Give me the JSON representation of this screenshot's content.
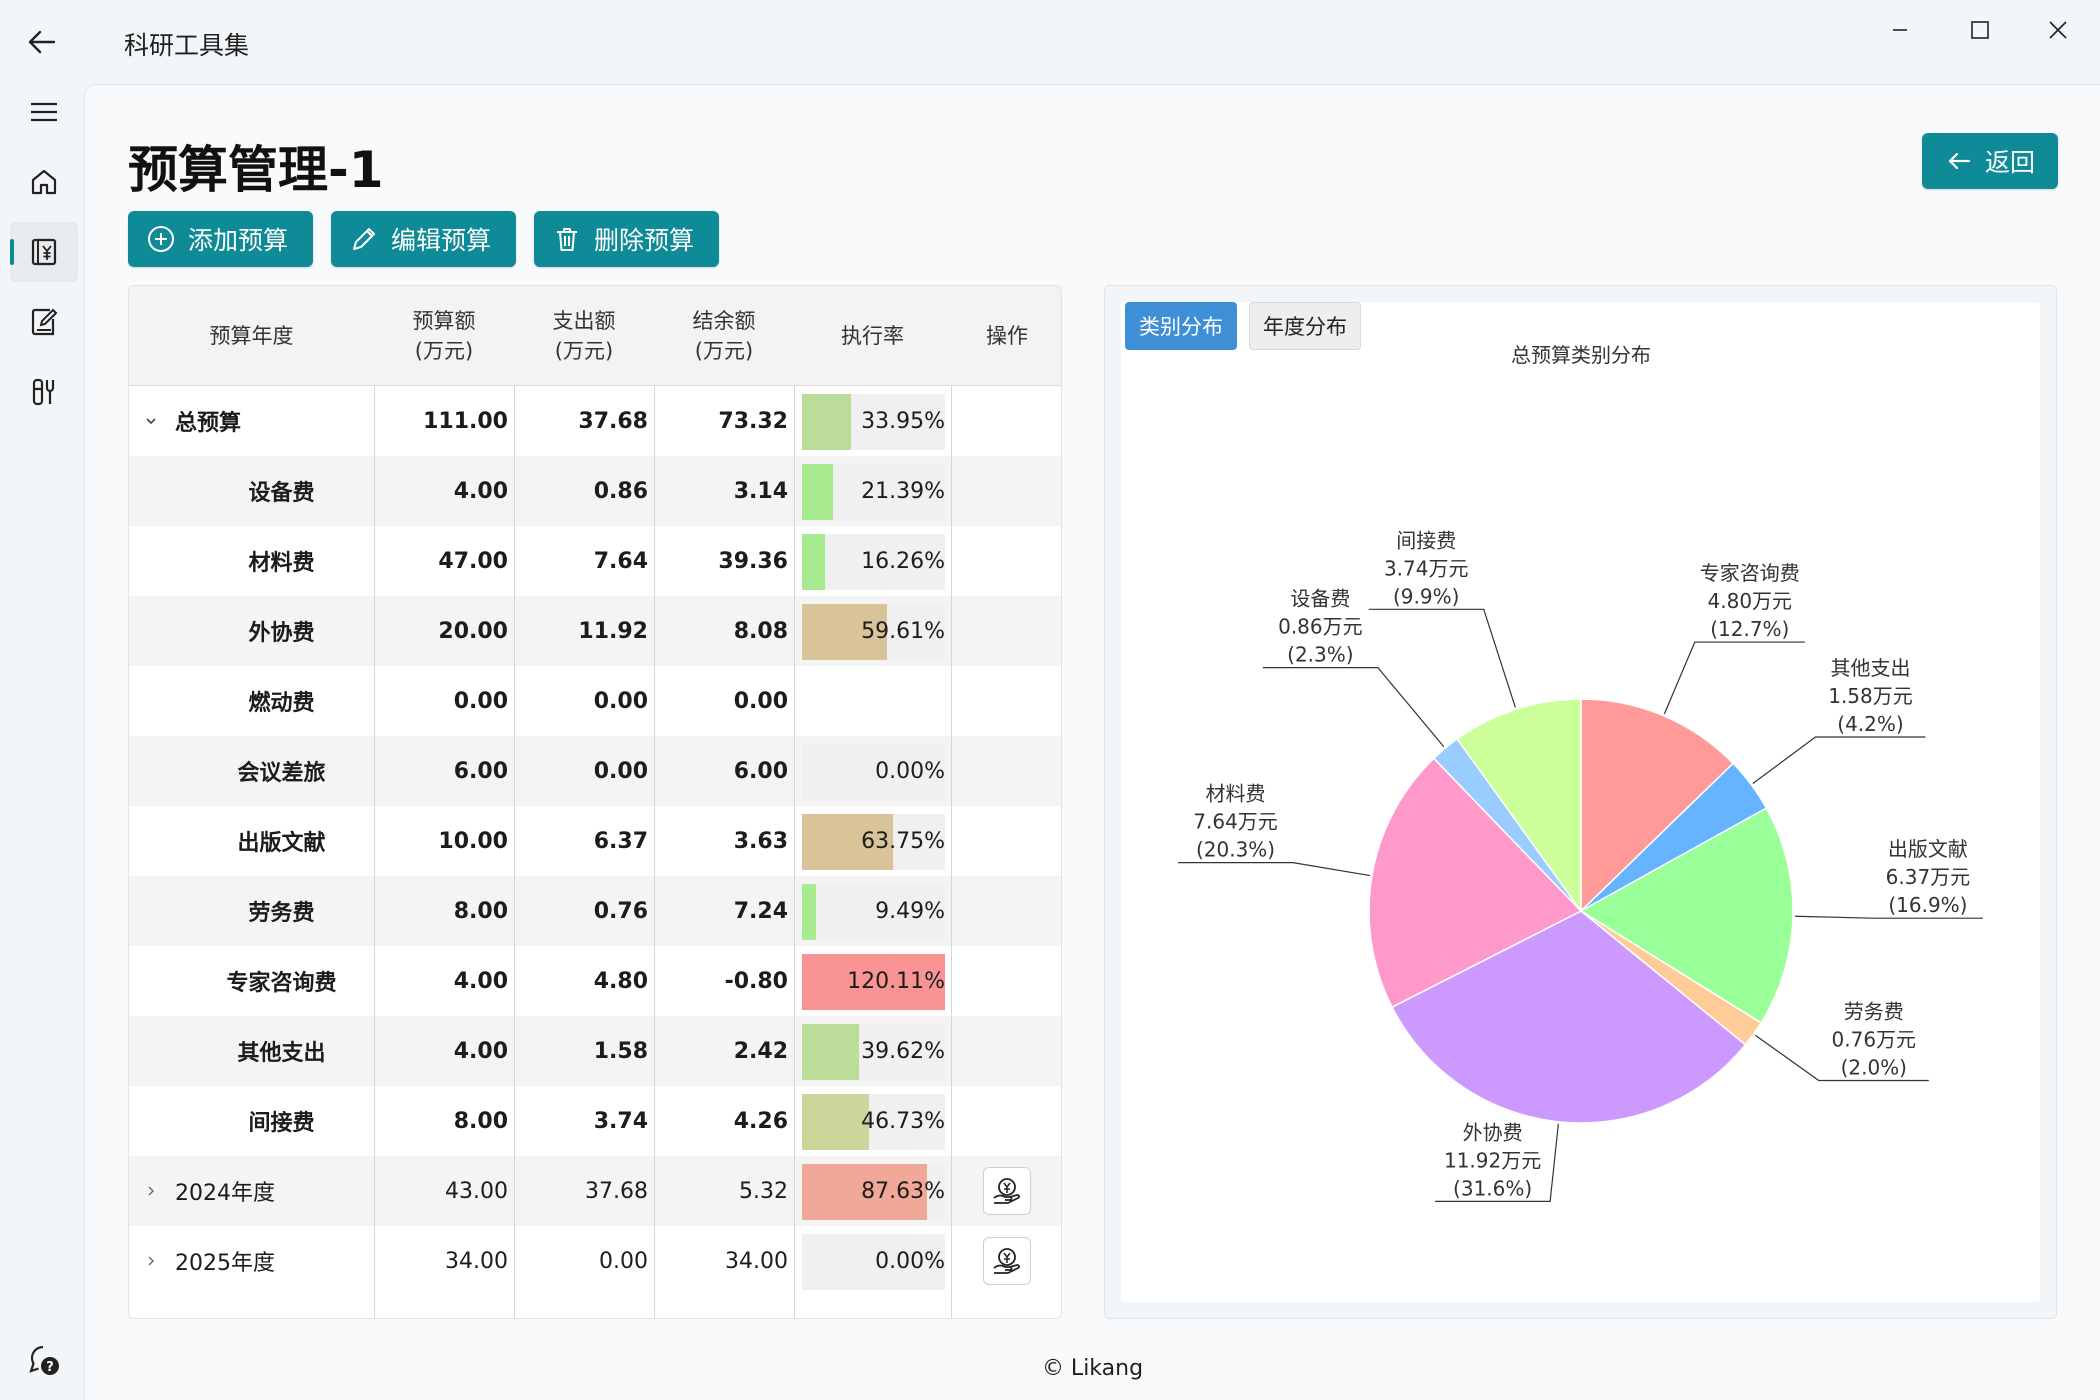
{
  "window": {
    "title": "科研工具集"
  },
  "page": {
    "title": "预算管理-1",
    "back_label": "返回"
  },
  "toolbar": {
    "add_label": "添加预算",
    "edit_label": "编辑预算",
    "delete_label": "删除预算"
  },
  "table": {
    "headers": {
      "year": "预算年度",
      "budget": "预算额",
      "budget_unit": "(万元)",
      "spent": "支出额",
      "spent_unit": "(万元)",
      "balance": "结余额",
      "balance_unit": "(万元)",
      "rate": "执行率",
      "ops": "操作"
    },
    "rows": [
      {
        "name": "总预算",
        "budget": "111.00",
        "spent": "37.68",
        "balance": "73.32",
        "rate_text": "33.95%",
        "rate": 0.3395,
        "bar_color": "#bcdc9a",
        "level": 0,
        "expanded": true
      },
      {
        "name": "设备费",
        "budget": "4.00",
        "spent": "0.86",
        "balance": "3.14",
        "rate_text": "21.39%",
        "rate": 0.2139,
        "bar_color": "#a8ea90",
        "level": 1
      },
      {
        "name": "材料费",
        "budget": "47.00",
        "spent": "7.64",
        "balance": "39.36",
        "rate_text": "16.26%",
        "rate": 0.1626,
        "bar_color": "#a8ea90",
        "level": 1
      },
      {
        "name": "外协费",
        "budget": "20.00",
        "spent": "11.92",
        "balance": "8.08",
        "rate_text": "59.61%",
        "rate": 0.5961,
        "bar_color": "#d9c398",
        "level": 1
      },
      {
        "name": "燃动费",
        "budget": "0.00",
        "spent": "0.00",
        "balance": "0.00",
        "rate_text": "",
        "rate": null,
        "bar_color": "",
        "level": 1
      },
      {
        "name": "会议差旅",
        "budget": "6.00",
        "spent": "0.00",
        "balance": "6.00",
        "rate_text": "0.00%",
        "rate": 0.0,
        "bar_color": "#a8ea90",
        "level": 1
      },
      {
        "name": "出版文献",
        "budget": "10.00",
        "spent": "6.37",
        "balance": "3.63",
        "rate_text": "63.75%",
        "rate": 0.6375,
        "bar_color": "#d9c398",
        "level": 1
      },
      {
        "name": "劳务费",
        "budget": "8.00",
        "spent": "0.76",
        "balance": "7.24",
        "rate_text": "9.49%",
        "rate": 0.0949,
        "bar_color": "#a8ea90",
        "level": 1
      },
      {
        "name": "专家咨询费",
        "budget": "4.00",
        "spent": "4.80",
        "balance": "-0.80",
        "rate_text": "120.11%",
        "rate": 1.0,
        "bar_color": "#fa9393",
        "level": 1
      },
      {
        "name": "其他支出",
        "budget": "4.00",
        "spent": "1.58",
        "balance": "2.42",
        "rate_text": "39.62%",
        "rate": 0.3962,
        "bar_color": "#bcdc9a",
        "level": 1
      },
      {
        "name": "间接费",
        "budget": "8.00",
        "spent": "3.74",
        "balance": "4.26",
        "rate_text": "46.73%",
        "rate": 0.4673,
        "bar_color": "#ccd69a",
        "level": 1
      },
      {
        "name": "2024年度",
        "budget": "43.00",
        "spent": "37.68",
        "balance": "5.32",
        "rate_text": "87.63%",
        "rate": 0.8763,
        "bar_color": "#f0a898",
        "level": 0,
        "expanded": false,
        "op": true
      },
      {
        "name": "2025年度",
        "budget": "34.00",
        "spent": "0.00",
        "balance": "34.00",
        "rate_text": "0.00%",
        "rate": 0.0,
        "bar_color": "#a8ea90",
        "level": 0,
        "expanded": false,
        "op": true
      }
    ]
  },
  "chart_tabs": {
    "category": "类别分布",
    "yearly": "年度分布",
    "active": "category"
  },
  "chart_data": {
    "type": "pie",
    "title": "总预算类别分布",
    "unit": "万元",
    "slices": [
      {
        "name": "专家咨询费",
        "value": 4.8,
        "percent": "12.7%",
        "color": "#ff9a98"
      },
      {
        "name": "其他支出",
        "value": 1.58,
        "percent": "4.2%",
        "color": "#66b3ff"
      },
      {
        "name": "出版文献",
        "value": 6.37,
        "percent": "16.9%",
        "color": "#99ff99"
      },
      {
        "name": "劳务费",
        "value": 0.76,
        "percent": "2.0%",
        "color": "#ffcc99"
      },
      {
        "name": "外协费",
        "value": 11.92,
        "percent": "31.6%",
        "color": "#cc99ff"
      },
      {
        "name": "材料费",
        "value": 7.64,
        "percent": "20.3%",
        "color": "#ff99cc"
      },
      {
        "name": "设备费",
        "value": 0.86,
        "percent": "2.3%",
        "color": "#99ccff"
      },
      {
        "name": "间接费",
        "value": 3.74,
        "percent": "9.9%",
        "color": "#ccff99"
      }
    ]
  },
  "footer": {
    "text": "© Likang"
  }
}
